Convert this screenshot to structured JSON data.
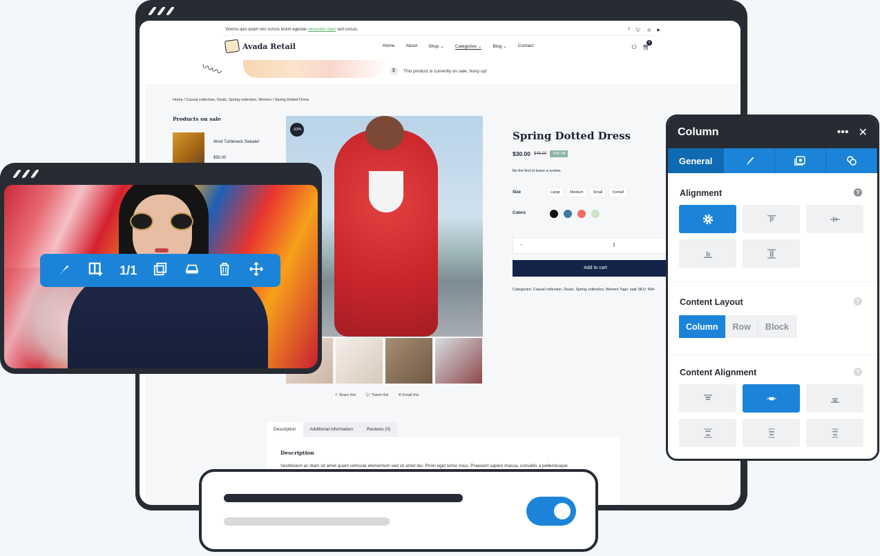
{
  "site": {
    "topbar_text": "Viverra quis quam nec cursus lorem egestas ",
    "topbar_link": "venenatis diam",
    "topbar_tail": " sed cursus.",
    "social_icons": [
      "facebook-icon",
      "twitter-icon",
      "instagram-icon",
      "youtube-icon"
    ],
    "logo": "Avada Retail",
    "nav": [
      "Home",
      "About",
      "Shop ⌄",
      "Categories ⌄",
      "Blog ⌄",
      "Contact"
    ],
    "cart_count": "0",
    "banner": "This product is currently on sale, hurry up!",
    "breadcrumb": "Home  /  Casual collection, Deals, Spring collection, Women  /  Spring Dotted Dress"
  },
  "sidebar": {
    "title": "Products on sale",
    "item_name": "Wool Turtleneck Sweater",
    "item_price": "$50.00"
  },
  "product": {
    "sale_tag": "-33%",
    "title": "Spring Dotted Dress",
    "price": "$30.00",
    "old_price": "$45.00",
    "off": "33% Off",
    "review": "Be the first to leave a review.",
    "size_label": "Size",
    "sizes": [
      "Large",
      "Medium",
      "Small",
      "Xsmall"
    ],
    "colors_label": "Colors",
    "colors": [
      "#111111",
      "#3f7aa8",
      "#ee6c64",
      "#cfe3c6"
    ],
    "qty_minus": "-",
    "qty": "1",
    "add_to_cart": "Add to cart",
    "meta": "Categories: Casual collection, Deals, Spring collection, Women   Tags: sale   SKU: N/A",
    "share": [
      "Share this",
      "Tweet this",
      "Email this"
    ],
    "tabs": [
      "Description",
      "Additional information",
      "Reviews (0)"
    ],
    "desc_heading": "Description",
    "desc_text": "Vestibulum ac diam sit amet quam vehicula elementum sed sit amet dui. Proin eget tortor risus. Praesent sapien massa, convallis a pellentesque"
  },
  "toolbar": {
    "counter": "1/1",
    "icons": [
      "brush-icon",
      "add-column-icon",
      "clone-icon",
      "save-icon",
      "trash-icon",
      "move-icon"
    ]
  },
  "panel": {
    "title": "Column",
    "tabs": [
      "General"
    ],
    "alignment_title": "Alignment",
    "content_layout_title": "Content Layout",
    "layout_options": [
      "Column",
      "Row",
      "Block"
    ],
    "content_alignment_title": "Content Alignment",
    "help": "?"
  },
  "colors": {
    "accent": "#1b84d8",
    "dark": "#272b33",
    "navy": "#14234a"
  }
}
